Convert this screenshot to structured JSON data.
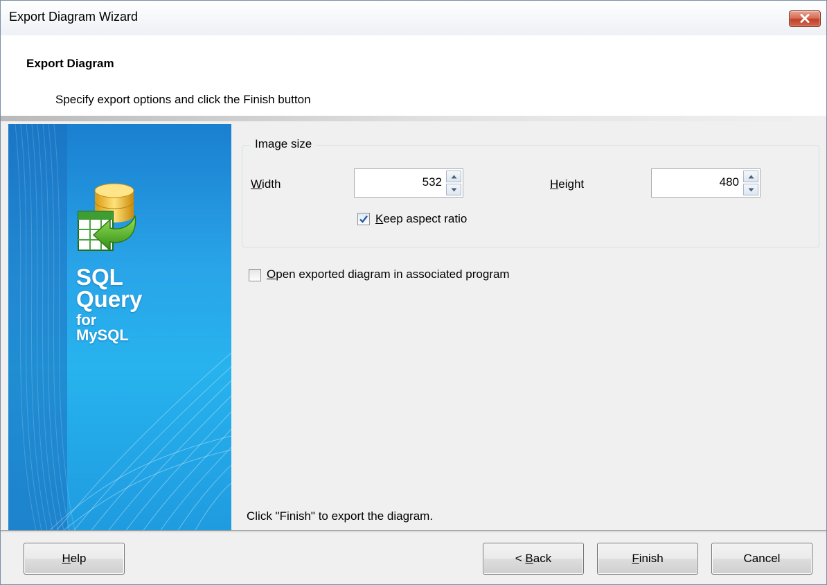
{
  "window": {
    "title": "Export Diagram Wizard"
  },
  "header": {
    "title": "Export Diagram",
    "description": "Specify export options and click the Finish button"
  },
  "sidebar": {
    "brand_line1": "SQL",
    "brand_line2": "Query",
    "brand_line3": "for",
    "brand_line4": "MySQL"
  },
  "image_size": {
    "legend": "Image size",
    "width_label_mnemonic": "W",
    "width_label_rest": "idth",
    "width_value": "532",
    "height_label_mnemonic": "H",
    "height_label_rest": "eight",
    "height_value": "480",
    "keep_aspect_mnemonic": "K",
    "keep_aspect_rest": "eep aspect ratio",
    "keep_aspect_checked": true
  },
  "open_exported": {
    "mnemonic": "O",
    "rest": "pen exported diagram in associated program",
    "checked": false
  },
  "hint": "Click \"Finish\" to export the diagram.",
  "buttons": {
    "help_mnemonic": "H",
    "help_rest": "elp",
    "back_prefix": "< ",
    "back_mnemonic": "B",
    "back_rest": "ack",
    "finish_mnemonic": "F",
    "finish_rest": "inish",
    "cancel": "Cancel"
  },
  "colors": {
    "sidebar_blue": "#29a4e8",
    "close_red": "#c2402a",
    "check_blue": "#2a5ca8"
  }
}
